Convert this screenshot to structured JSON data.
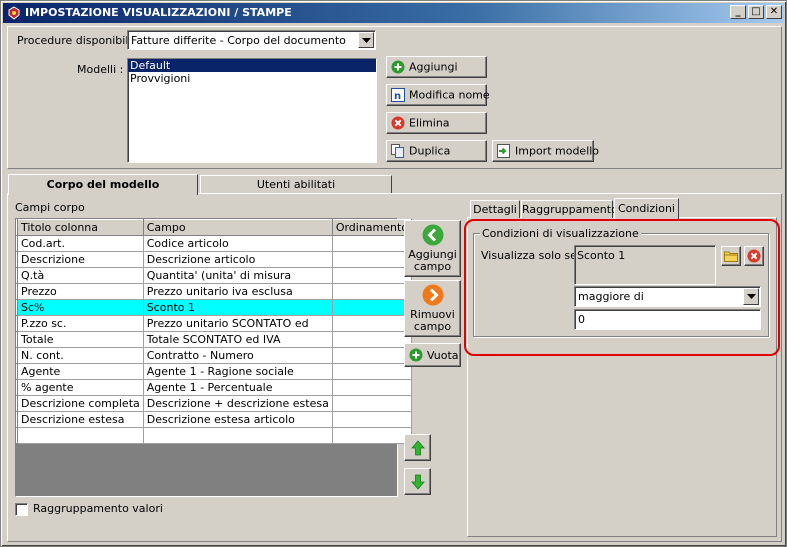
{
  "window": {
    "title": "IMPOSTAZIONE VISUALIZZAZIONI / STAMPE",
    "controls": {
      "minimize": "_",
      "maximize": "□",
      "close": "✕"
    }
  },
  "top": {
    "procedure_label": "Procedure disponibili :",
    "procedure_value": "Fatture differite - Corpo del documento",
    "modelli_label": "Modelli :",
    "modelli": [
      {
        "label": "Default",
        "selected": true
      },
      {
        "label": "Provvigioni",
        "selected": false
      }
    ],
    "buttons": {
      "aggiungi": "Aggiungi",
      "modifica_nome": "Modifica nome",
      "elimina": "Elimina",
      "duplica": "Duplica",
      "import_modello": "Import modello"
    }
  },
  "tabs": {
    "corpo": "Corpo del modello",
    "utenti": "Utenti abilitati"
  },
  "grid": {
    "caption": "Campi corpo",
    "columns": [
      "Titolo colonna",
      "Campo",
      "Ordinamento"
    ],
    "rows": [
      {
        "titolo": "Cod.art.",
        "campo": "Codice articolo",
        "ordinamento": "",
        "highlight": false
      },
      {
        "titolo": "Descrizione",
        "campo": "Descrizione articolo",
        "ordinamento": "",
        "highlight": false
      },
      {
        "titolo": "Q.tà",
        "campo": "Quantita' (unita' di misura",
        "ordinamento": "",
        "highlight": false
      },
      {
        "titolo": "Prezzo",
        "campo": "Prezzo unitario iva esclusa",
        "ordinamento": "",
        "highlight": false
      },
      {
        "titolo": "Sc%",
        "campo": "Sconto 1",
        "ordinamento": "",
        "highlight": true
      },
      {
        "titolo": "P.zzo sc.",
        "campo": "Prezzo unitario SCONTATO ed",
        "ordinamento": "",
        "highlight": false
      },
      {
        "titolo": "Totale",
        "campo": "Totale SCONTATO ed IVA",
        "ordinamento": "",
        "highlight": false
      },
      {
        "titolo": "N. cont.",
        "campo": "Contratto - Numero",
        "ordinamento": "",
        "highlight": false
      },
      {
        "titolo": "Agente",
        "campo": "Agente 1 - Ragione sociale",
        "ordinamento": "",
        "highlight": false
      },
      {
        "titolo": "% agente",
        "campo": "Agente 1 - Percentuale",
        "ordinamento": "",
        "highlight": false
      },
      {
        "titolo": "Descrizione completa",
        "campo": "Descrizione + descrizione estesa",
        "ordinamento": "",
        "highlight": false
      },
      {
        "titolo": "Descrizione estesa",
        "campo": "Descrizione estesa articolo",
        "ordinamento": "",
        "highlight": false
      },
      {
        "titolo": "",
        "campo": "",
        "ordinamento": "",
        "highlight": false
      }
    ],
    "highlight_color": "#00ffff"
  },
  "side_buttons": {
    "aggiungi_campo_1": "Aggiungi",
    "aggiungi_campo_2": "campo",
    "rimuovi_campo_1": "Rimuovi",
    "rimuovi_campo_2": "campo",
    "vuota": "Vuota"
  },
  "raggruppamento_valori": {
    "label": "Raggruppamento valori",
    "checked": false
  },
  "right_tabs": {
    "dettagli": "Dettagli",
    "raggruppamento": "Raggruppamento",
    "condizioni": "Condizioni",
    "active": "Condizioni"
  },
  "condizioni": {
    "group_title": "Condizioni di visualizzazione",
    "visualizza_label": "Visualizza solo se :",
    "field_value": "Sconto 1",
    "operator_value": "maggiore di",
    "compare_value": "0"
  },
  "colors": {
    "titlebar_start": "#0a246a",
    "titlebar_end": "#a6caf0",
    "selection": "#0a246a",
    "annotation_red": "#e00000",
    "face": "#d4d0c8"
  }
}
